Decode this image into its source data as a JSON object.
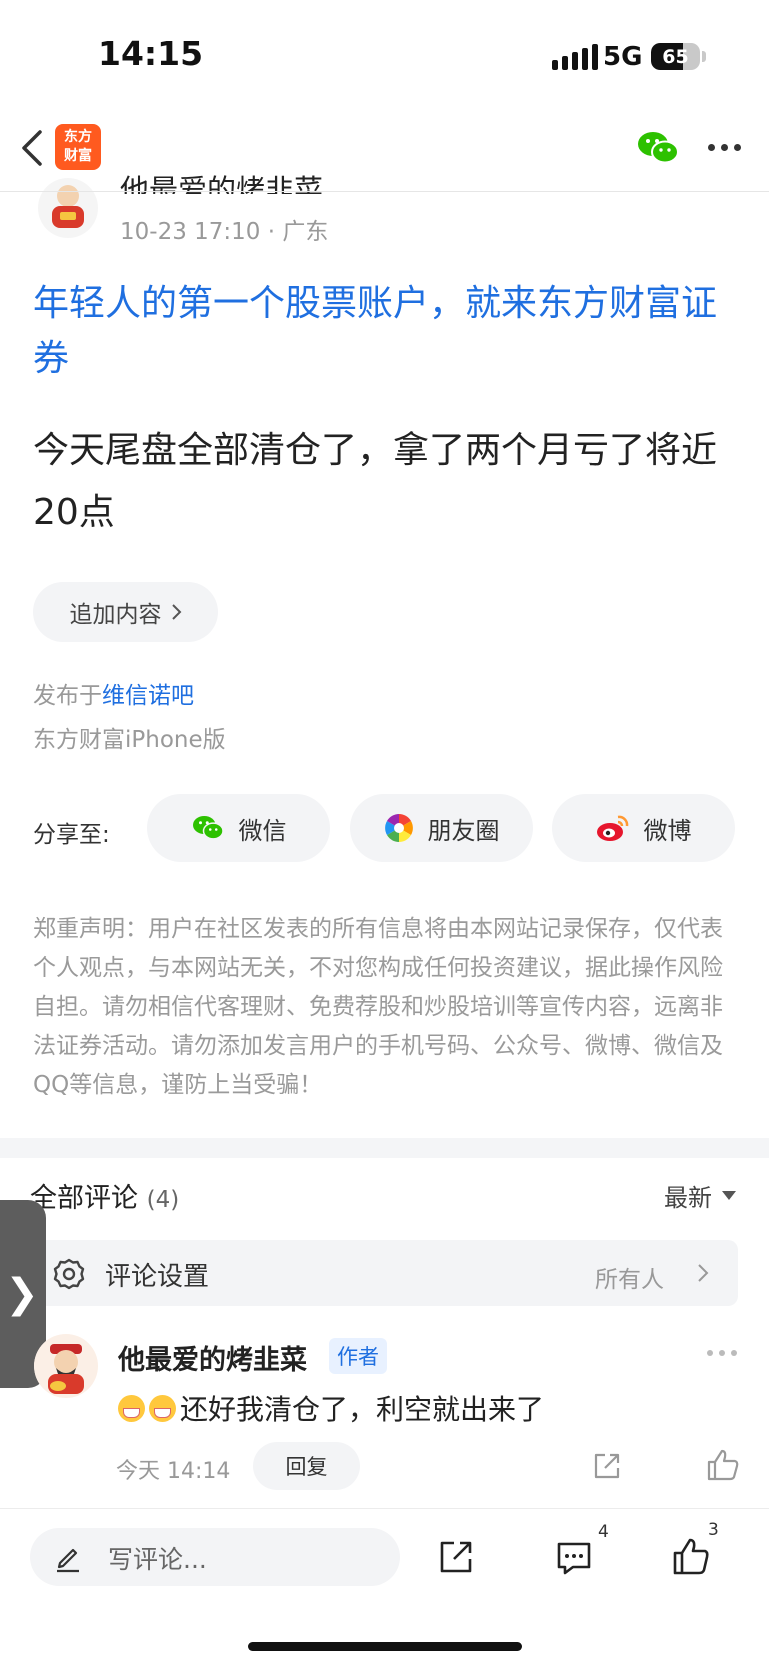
{
  "status_bar": {
    "time": "14:15",
    "network": "5G",
    "battery": "65",
    "battery_level": 0.65
  },
  "nav": {
    "logo_line1": "东方",
    "logo_line2": "财富"
  },
  "post": {
    "author_name_partial": "他最爱的烤韭菜",
    "meta": "10-23 17:10 · 广东",
    "title": "年轻人的第一个股票账户，就来东方财富证券",
    "body": "今天尾盘全部清仓了，拿了两个月亏了将近20点",
    "append_label": "追加内容",
    "published_prefix": "发布于",
    "published_bar": "维信诺吧",
    "client": "东方财富iPhone版"
  },
  "share": {
    "label": "分享至:",
    "options": [
      {
        "label": "微信",
        "icon": "wechat-icon"
      },
      {
        "label": "朋友圈",
        "icon": "moments-icon"
      },
      {
        "label": "微博",
        "icon": "weibo-icon"
      }
    ]
  },
  "disclaimer": "郑重声明：用户在社区发表的所有信息将由本网站记录保存，仅代表个人观点，与本网站无关，不对您构成任何投资建议，据此操作风险自担。请勿相信代客理财、免费荐股和炒股培训等宣传内容，远离非法证券活动。请勿添加发言用户的手机号码、公众号、微博、微信及QQ等信息，谨防上当受骗！",
  "comments": {
    "title": "全部评论",
    "count": "(4)",
    "sort": "最新",
    "setting_label": "评论设置",
    "setting_value": "所有人",
    "side_tab": "❯",
    "items": [
      {
        "name": "他最爱的烤韭菜",
        "badge": "作者",
        "text": "还好我清仓了，利空就出来了",
        "time": "今天 14:14",
        "reply": "回复"
      }
    ]
  },
  "bottom_bar": {
    "write_placeholder": "写评论...",
    "comment_count": "4",
    "like_count": "3"
  },
  "colors": {
    "link_blue": "#1f6fe0",
    "brand_orange": "#ff5a1f",
    "wechat_green": "#2dc100"
  }
}
